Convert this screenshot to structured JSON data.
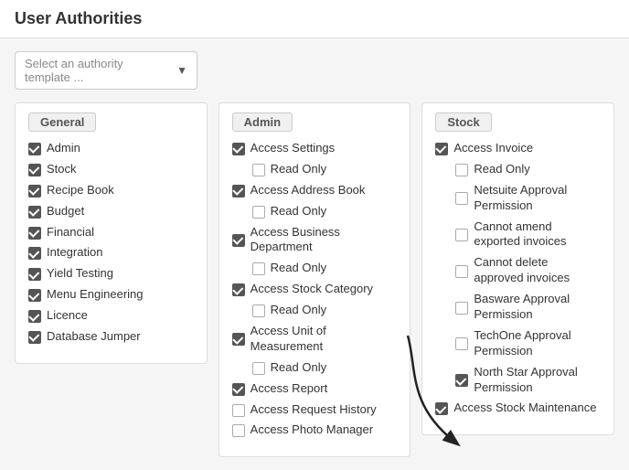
{
  "page": {
    "title": "User Authorities"
  },
  "template_select": {
    "placeholder": "Select an authority template ...",
    "arrow": "▼"
  },
  "columns": [
    {
      "id": "general",
      "header": "General",
      "items": [
        {
          "label": "Admin",
          "checked": true,
          "sub": false
        },
        {
          "label": "Stock",
          "checked": true,
          "sub": false
        },
        {
          "label": "Recipe Book",
          "checked": true,
          "sub": false
        },
        {
          "label": "Budget",
          "checked": true,
          "sub": false
        },
        {
          "label": "Financial",
          "checked": true,
          "sub": false
        },
        {
          "label": "Integration",
          "checked": true,
          "sub": false
        },
        {
          "label": "Yield Testing",
          "checked": true,
          "sub": false
        },
        {
          "label": "Menu Engineering",
          "checked": true,
          "sub": false
        },
        {
          "label": "Licence",
          "checked": true,
          "sub": false
        },
        {
          "label": "Database Jumper",
          "checked": true,
          "sub": false
        }
      ]
    },
    {
      "id": "admin",
      "header": "Admin",
      "items": [
        {
          "label": "Access Settings",
          "checked": true,
          "sub": false
        },
        {
          "label": "Read Only",
          "checked": false,
          "sub": true
        },
        {
          "label": "Access Address Book",
          "checked": true,
          "sub": false
        },
        {
          "label": "Read Only",
          "checked": false,
          "sub": true
        },
        {
          "label": "Access Business Department",
          "checked": true,
          "sub": false
        },
        {
          "label": "Read Only",
          "checked": false,
          "sub": true
        },
        {
          "label": "Access Stock Category",
          "checked": true,
          "sub": false
        },
        {
          "label": "Read Only",
          "checked": false,
          "sub": true
        },
        {
          "label": "Access Unit of Measurement",
          "checked": true,
          "sub": false
        },
        {
          "label": "Read Only",
          "checked": false,
          "sub": true
        },
        {
          "label": "Access Report",
          "checked": true,
          "sub": false
        },
        {
          "label": "Access Request History",
          "checked": false,
          "sub": false
        },
        {
          "label": "Access Photo Manager",
          "checked": false,
          "sub": false
        }
      ]
    },
    {
      "id": "stock",
      "header": "Stock",
      "items": [
        {
          "label": "Access Invoice",
          "checked": true,
          "sub": false
        },
        {
          "label": "Read Only",
          "checked": false,
          "sub": true
        },
        {
          "label": "Netsuite Approval Permission",
          "checked": false,
          "sub": true
        },
        {
          "label": "Cannot amend exported invoices",
          "checked": false,
          "sub": true
        },
        {
          "label": "Cannot delete approved invoices",
          "checked": false,
          "sub": true
        },
        {
          "label": "Basware Approval Permission",
          "checked": false,
          "sub": true
        },
        {
          "label": "TechOne Approval Permission",
          "checked": false,
          "sub": true
        },
        {
          "label": "North Star Approval Permission",
          "checked": true,
          "sub": true
        },
        {
          "label": "Access Stock Maintenance",
          "checked": true,
          "sub": false
        }
      ]
    }
  ]
}
